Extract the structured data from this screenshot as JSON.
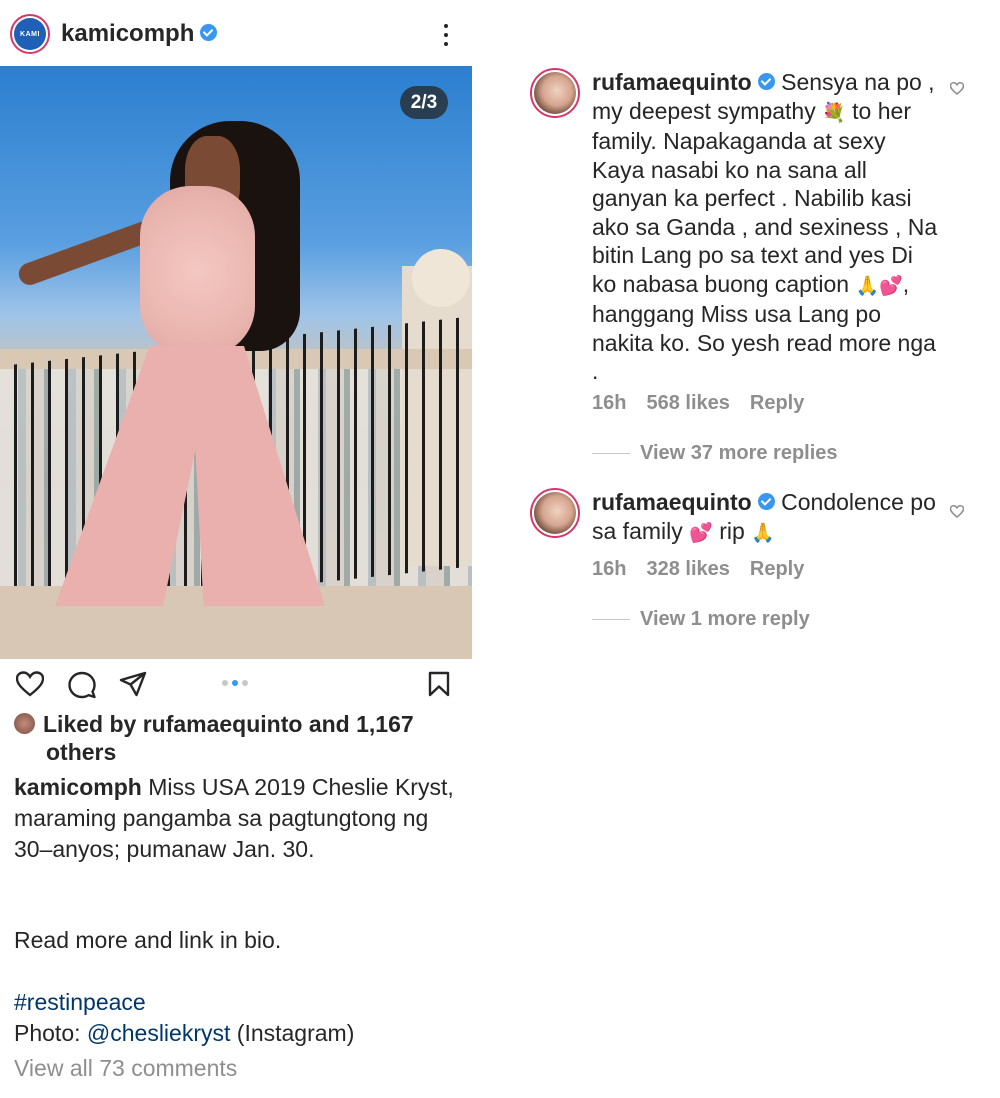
{
  "post": {
    "username": "kamicomph",
    "avatar_text": "KAMI",
    "slide_counter": "2/3",
    "liked_by_line1": "Liked by rufamaequinto and 1,167",
    "liked_by_line2": "others",
    "caption_user": "kamicomph",
    "caption_text": " Miss USA 2019 Cheslie Kryst, maraming pangamba sa pagtungtong ng 30–anyos; pumanaw Jan. 30.",
    "read_more": "Read more and link in bio.",
    "hashtag": "#restinpeace",
    "photo_prefix": "Photo: ",
    "photo_mention": "@chesliekryst",
    "photo_suffix": " (Instagram)",
    "view_all_comments": "View all 73 comments"
  },
  "comments": [
    {
      "username": "rufamaequinto",
      "text_a": " Sensya na po , my deepest sympathy ",
      "emoji_a": "💐",
      "text_b": " to her family. Napakaganda at sexy Kaya nasabi ko na sana all ganyan ka perfect . Nabilib kasi ako sa Ganda , and sexiness , Na bitin Lang po sa text and yes Di ko nabasa buong caption ",
      "emoji_b": "🙏💕",
      "text_c": ", hanggang Miss usa Lang po nakita ko. So yesh read more nga .",
      "time": "16h",
      "likes": "568 likes",
      "reply": "Reply",
      "view_replies": "View 37 more replies"
    },
    {
      "username": "rufamaequinto",
      "text_a": " Condolence po sa family ",
      "emoji_a": "💕",
      "text_b": " rip ",
      "emoji_b": "🙏",
      "text_c": "",
      "time": "16h",
      "likes": "328 likes",
      "reply": "Reply",
      "view_replies": "View 1 more reply"
    }
  ],
  "colors": {
    "link": "#00376b",
    "verified": "#3897f0",
    "muted": "#8e8e8e",
    "text": "#262626"
  },
  "icons": [
    "heart-icon",
    "comment-icon",
    "share-icon",
    "bookmark-icon",
    "more-icon",
    "verified-icon"
  ]
}
